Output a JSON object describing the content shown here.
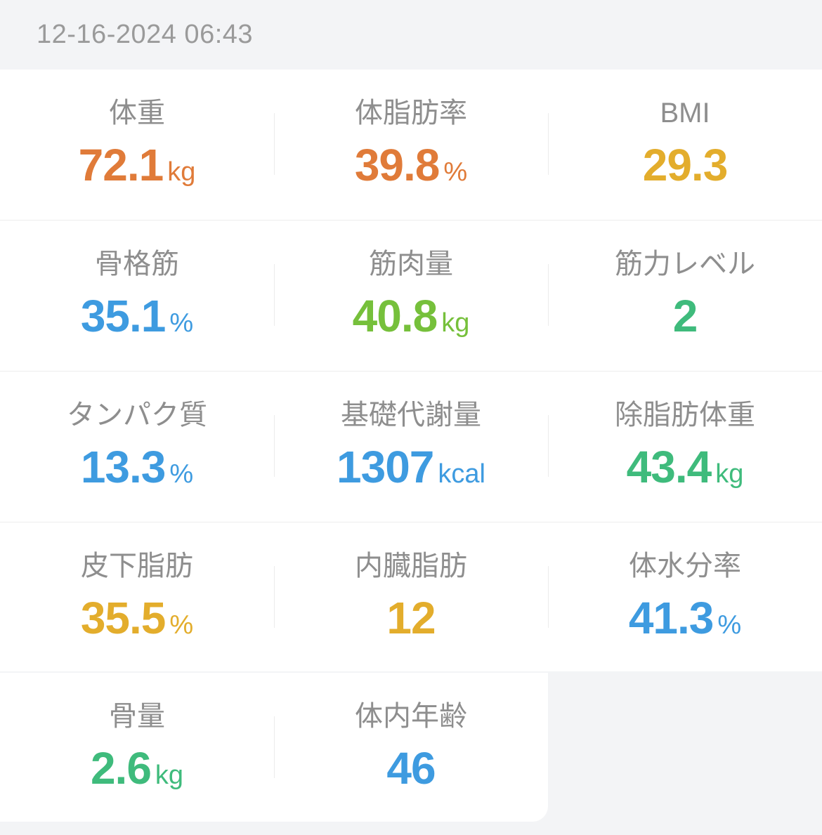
{
  "timestamp": "12-16-2024 06:43",
  "colors": {
    "orange": "#e07b39",
    "yellow": "#e3ad2c",
    "blue": "#3e9be0",
    "lime": "#76c03b",
    "green": "#3fbb7c",
    "label": "#8e8e8e"
  },
  "metrics": [
    {
      "label": "体重",
      "value": "72.1",
      "unit": "kg",
      "color": "#e07b39"
    },
    {
      "label": "体脂肪率",
      "value": "39.8",
      "unit": "%",
      "color": "#e07b39"
    },
    {
      "label": "BMI",
      "value": "29.3",
      "unit": "",
      "color": "#e3ad2c"
    },
    {
      "label": "骨格筋",
      "value": "35.1",
      "unit": "%",
      "color": "#3e9be0"
    },
    {
      "label": "筋肉量",
      "value": "40.8",
      "unit": "kg",
      "color": "#76c03b"
    },
    {
      "label": "筋力レベル",
      "value": "2",
      "unit": "",
      "color": "#3fbb7c"
    },
    {
      "label": "タンパク質",
      "value": "13.3",
      "unit": "%",
      "color": "#3e9be0"
    },
    {
      "label": "基礎代謝量",
      "value": "1307",
      "unit": "kcal",
      "color": "#3e9be0"
    },
    {
      "label": "除脂肪体重",
      "value": "43.4",
      "unit": "kg",
      "color": "#3fbb7c"
    },
    {
      "label": "皮下脂肪",
      "value": "35.5",
      "unit": "%",
      "color": "#e3ad2c"
    },
    {
      "label": "内臓脂肪",
      "value": "12",
      "unit": "",
      "color": "#e3ad2c"
    },
    {
      "label": "体水分率",
      "value": "41.3",
      "unit": "%",
      "color": "#3e9be0"
    },
    {
      "label": "骨量",
      "value": "2.6",
      "unit": "kg",
      "color": "#3fbb7c"
    },
    {
      "label": "体内年齢",
      "value": "46",
      "unit": "",
      "color": "#3e9be0"
    }
  ]
}
